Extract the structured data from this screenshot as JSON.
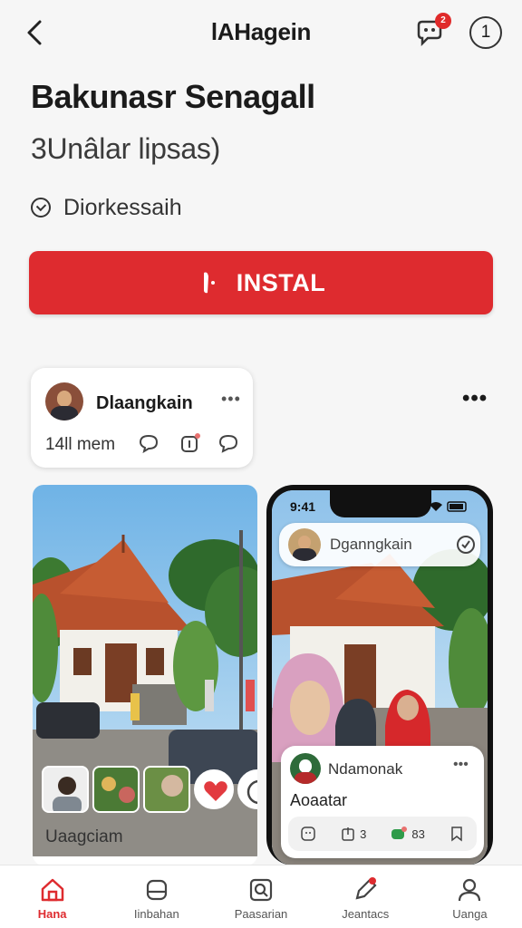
{
  "header": {
    "title": "lAHagein",
    "notification_count": "2",
    "info_label": "1"
  },
  "app": {
    "title": "Bakunasr Senagall",
    "subtitle": "3Unâlar lipsas)",
    "download_status": "Diorkessaih",
    "install_label": "INSTAL"
  },
  "post": {
    "author": "Dlaangkain",
    "menu": "•••",
    "meta": "14ll mem"
  },
  "more_menu": "•••",
  "photo_card": {
    "caption": "Uaagciam"
  },
  "phone": {
    "time": "9:41",
    "top_name": "Dganngkain",
    "card_name": "Ndamonak",
    "card_menu": "•••",
    "card_sub": "Aoaatar",
    "action_1": "3",
    "action_2": "83"
  },
  "tabs": [
    {
      "label": "Hana",
      "icon": "home-icon",
      "active": true
    },
    {
      "label": "Iinbahan",
      "icon": "inbox-icon",
      "active": false
    },
    {
      "label": "Paasarian",
      "icon": "search-icon",
      "active": false
    },
    {
      "label": "Jeantacs",
      "icon": "notes-icon",
      "active": false
    },
    {
      "label": "Uanga",
      "icon": "profile-icon",
      "active": false
    }
  ],
  "colors": {
    "accent": "#de2b2f",
    "background": "#f6f6f6"
  }
}
